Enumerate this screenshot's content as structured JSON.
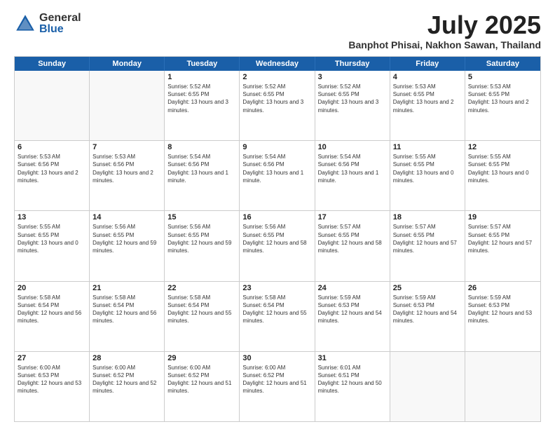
{
  "header": {
    "logo_general": "General",
    "logo_blue": "Blue",
    "month_year": "July 2025",
    "location": "Banphot Phisai, Nakhon Sawan, Thailand"
  },
  "days_of_week": [
    "Sunday",
    "Monday",
    "Tuesday",
    "Wednesday",
    "Thursday",
    "Friday",
    "Saturday"
  ],
  "weeks": [
    [
      {
        "day": "",
        "empty": true
      },
      {
        "day": "",
        "empty": true
      },
      {
        "day": "1",
        "rise": "5:52 AM",
        "set": "6:55 PM",
        "daylight": "13 hours and 3 minutes."
      },
      {
        "day": "2",
        "rise": "5:52 AM",
        "set": "6:55 PM",
        "daylight": "13 hours and 3 minutes."
      },
      {
        "day": "3",
        "rise": "5:52 AM",
        "set": "6:55 PM",
        "daylight": "13 hours and 3 minutes."
      },
      {
        "day": "4",
        "rise": "5:53 AM",
        "set": "6:55 PM",
        "daylight": "13 hours and 2 minutes."
      },
      {
        "day": "5",
        "rise": "5:53 AM",
        "set": "6:55 PM",
        "daylight": "13 hours and 2 minutes."
      }
    ],
    [
      {
        "day": "6",
        "rise": "5:53 AM",
        "set": "6:56 PM",
        "daylight": "13 hours and 2 minutes."
      },
      {
        "day": "7",
        "rise": "5:53 AM",
        "set": "6:56 PM",
        "daylight": "13 hours and 2 minutes."
      },
      {
        "day": "8",
        "rise": "5:54 AM",
        "set": "6:56 PM",
        "daylight": "13 hours and 1 minute."
      },
      {
        "day": "9",
        "rise": "5:54 AM",
        "set": "6:56 PM",
        "daylight": "13 hours and 1 minute."
      },
      {
        "day": "10",
        "rise": "5:54 AM",
        "set": "6:56 PM",
        "daylight": "13 hours and 1 minute."
      },
      {
        "day": "11",
        "rise": "5:55 AM",
        "set": "6:55 PM",
        "daylight": "13 hours and 0 minutes."
      },
      {
        "day": "12",
        "rise": "5:55 AM",
        "set": "6:55 PM",
        "daylight": "13 hours and 0 minutes."
      }
    ],
    [
      {
        "day": "13",
        "rise": "5:55 AM",
        "set": "6:55 PM",
        "daylight": "13 hours and 0 minutes."
      },
      {
        "day": "14",
        "rise": "5:56 AM",
        "set": "6:55 PM",
        "daylight": "12 hours and 59 minutes."
      },
      {
        "day": "15",
        "rise": "5:56 AM",
        "set": "6:55 PM",
        "daylight": "12 hours and 59 minutes."
      },
      {
        "day": "16",
        "rise": "5:56 AM",
        "set": "6:55 PM",
        "daylight": "12 hours and 58 minutes."
      },
      {
        "day": "17",
        "rise": "5:57 AM",
        "set": "6:55 PM",
        "daylight": "12 hours and 58 minutes."
      },
      {
        "day": "18",
        "rise": "5:57 AM",
        "set": "6:55 PM",
        "daylight": "12 hours and 57 minutes."
      },
      {
        "day": "19",
        "rise": "5:57 AM",
        "set": "6:55 PM",
        "daylight": "12 hours and 57 minutes."
      }
    ],
    [
      {
        "day": "20",
        "rise": "5:58 AM",
        "set": "6:54 PM",
        "daylight": "12 hours and 56 minutes."
      },
      {
        "day": "21",
        "rise": "5:58 AM",
        "set": "6:54 PM",
        "daylight": "12 hours and 56 minutes."
      },
      {
        "day": "22",
        "rise": "5:58 AM",
        "set": "6:54 PM",
        "daylight": "12 hours and 55 minutes."
      },
      {
        "day": "23",
        "rise": "5:58 AM",
        "set": "6:54 PM",
        "daylight": "12 hours and 55 minutes."
      },
      {
        "day": "24",
        "rise": "5:59 AM",
        "set": "6:53 PM",
        "daylight": "12 hours and 54 minutes."
      },
      {
        "day": "25",
        "rise": "5:59 AM",
        "set": "6:53 PM",
        "daylight": "12 hours and 54 minutes."
      },
      {
        "day": "26",
        "rise": "5:59 AM",
        "set": "6:53 PM",
        "daylight": "12 hours and 53 minutes."
      }
    ],
    [
      {
        "day": "27",
        "rise": "6:00 AM",
        "set": "6:53 PM",
        "daylight": "12 hours and 53 minutes."
      },
      {
        "day": "28",
        "rise": "6:00 AM",
        "set": "6:52 PM",
        "daylight": "12 hours and 52 minutes."
      },
      {
        "day": "29",
        "rise": "6:00 AM",
        "set": "6:52 PM",
        "daylight": "12 hours and 51 minutes."
      },
      {
        "day": "30",
        "rise": "6:00 AM",
        "set": "6:52 PM",
        "daylight": "12 hours and 51 minutes."
      },
      {
        "day": "31",
        "rise": "6:01 AM",
        "set": "6:51 PM",
        "daylight": "12 hours and 50 minutes."
      },
      {
        "day": "",
        "empty": true
      },
      {
        "day": "",
        "empty": true
      }
    ]
  ]
}
